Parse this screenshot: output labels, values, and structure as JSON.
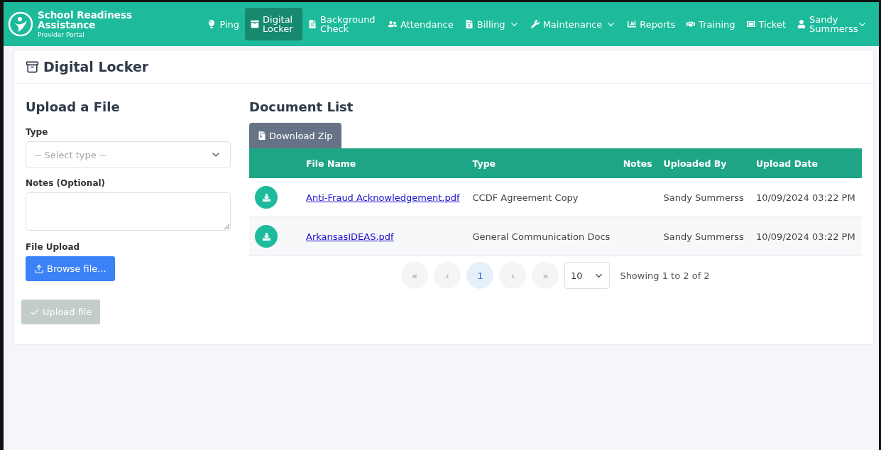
{
  "brand": {
    "title": "School Readiness Assistance",
    "subtitle": "Provider Portal"
  },
  "nav": [
    {
      "label": "Ping",
      "selected": false,
      "has_menu": false
    },
    {
      "label": "Digital Locker",
      "selected": true,
      "has_menu": false
    },
    {
      "label": "Background Check",
      "selected": false,
      "has_menu": false
    },
    {
      "label": "Attendance",
      "selected": false,
      "has_menu": false
    },
    {
      "label": "Billing",
      "selected": false,
      "has_menu": true
    },
    {
      "label": "Maintenance",
      "selected": false,
      "has_menu": true
    },
    {
      "label": "Reports",
      "selected": false,
      "has_menu": false
    },
    {
      "label": "Training",
      "selected": false,
      "has_menu": false
    },
    {
      "label": "Ticket",
      "selected": false,
      "has_menu": false
    },
    {
      "label": "Sandy Summerss",
      "selected": false,
      "has_menu": true
    }
  ],
  "page_title": "Digital Locker",
  "upload": {
    "title": "Upload a File",
    "type_label": "Type",
    "type_placeholder": "-- Select type --",
    "notes_label": "Notes (Optional)",
    "file_label": "File Upload",
    "browse_button": "Browse file...",
    "submit_button": "Upload file",
    "submit_disabled": true
  },
  "documents": {
    "title": "Document List",
    "download_button": "Download Zip",
    "columns": [
      "File Name",
      "Type",
      "Notes",
      "Uploaded By",
      "Upload Date"
    ],
    "rows": [
      {
        "file_name": "Anti-Fraud Acknowledgement.pdf",
        "type": "CCDF Agreement Copy",
        "uploaded_by": "Sandy Summerss",
        "upload_date": "10/09/2024 03:22 PM"
      },
      {
        "file_name": "ArkansasIDEAS.pdf",
        "type": "General Communication Docs",
        "uploaded_by": "Sandy Summerss",
        "upload_date": "10/09/2024 03:22 PM"
      }
    ],
    "pager": [
      {
        "label": "«",
        "selected": false
      },
      {
        "label": "‹",
        "selected": false
      },
      {
        "label": "1",
        "selected": true
      },
      {
        "label": "›",
        "selected": false
      },
      {
        "label": "»",
        "selected": false
      }
    ],
    "page_size": "10",
    "summary": "Showing 1 to 2 of 2"
  }
}
